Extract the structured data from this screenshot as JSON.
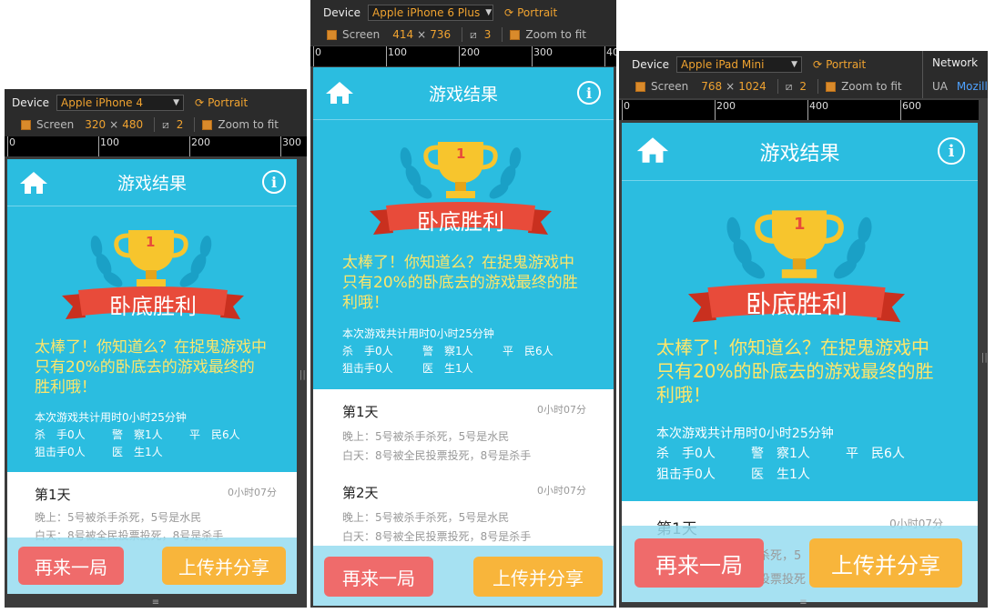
{
  "toolbar": {
    "device_label": "Device",
    "screen_label": "Screen",
    "zoom_label": "Zoom to fit",
    "orientation": "Portrait",
    "times": "×",
    "network_tab": "Network",
    "ua_label": "UA",
    "ua_value": "Mozilla"
  },
  "devices": [
    {
      "name": "Apple iPhone 4",
      "width": "320",
      "height": "480",
      "ratio": "2",
      "ruler": [
        "0",
        "100",
        "200",
        "300"
      ]
    },
    {
      "name": "Apple iPhone 6 Plus",
      "width": "414",
      "height": "736",
      "ratio": "3",
      "ruler": [
        "0",
        "100",
        "200",
        "300",
        "40"
      ]
    },
    {
      "name": "Apple iPad Mini",
      "width": "768",
      "height": "1024",
      "ratio": "2",
      "ruler": [
        "0",
        "200",
        "400",
        "600"
      ]
    }
  ],
  "app": {
    "title": "游戏结果",
    "trophy_rank": "1",
    "result": "卧底胜利",
    "message": "太棒了！你知道么？在捉鬼游戏中只有20%的卧底去的游戏最终的胜利哦！",
    "duration": "本次游戏共计用时0小时25分钟",
    "roles": [
      "杀　手0人",
      "警　察1人",
      "平　民6人",
      "狙击手0人",
      "医　生1人"
    ],
    "days": [
      {
        "name": "第1天",
        "time": "0小时07分",
        "night": "晚上：5号被杀手杀死，5号是水民",
        "day": "白天：8号被全民投票投死，8号是杀手"
      },
      {
        "name": "第2天",
        "time": "0小时07分",
        "night": "晚上：5号被杀手杀死，5号是水民",
        "day": "白天：8号被全民投票投死，8号是杀手"
      }
    ],
    "ipad_night_fragment": "杀死，5",
    "ipad_day_fragment": "投票投死",
    "replay_button": "再来一局",
    "share_button": "上传并分享",
    "grip": "≡",
    "side_handle": "||"
  },
  "colors": {
    "screen_bg": "#2bbde0",
    "accent_orange": "#f0a330",
    "message": "#ffe66a",
    "replay": "#ef6b6b",
    "share": "#f8b53b"
  }
}
